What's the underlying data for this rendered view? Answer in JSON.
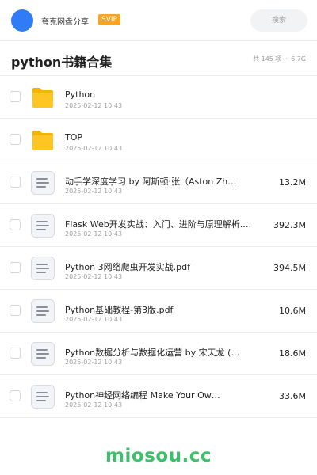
{
  "topbar": {
    "owner": "夸克网盘分享",
    "badge": "SVIP",
    "search_placeholder": "搜索"
  },
  "header": {
    "title": "python书籍合集",
    "count": "共 145 项",
    "separator": "·",
    "total_size": "6.7G"
  },
  "files": [
    {
      "type": "folder",
      "name": "Python",
      "date": "2025-02-12 10:43",
      "size": ""
    },
    {
      "type": "folder",
      "name": "TOP",
      "date": "2025-02-12 10:43",
      "size": ""
    },
    {
      "type": "document",
      "name": "动手学深度学习 by 阿斯顿·张（Aston Zh…",
      "date": "2025-02-12 10:43",
      "size": "13.2M"
    },
    {
      "type": "document",
      "name": "Flask Web开发实战：入门、进阶与原理解析.…",
      "date": "2025-02-12 10:43",
      "size": "392.3M"
    },
    {
      "type": "document",
      "name": "Python 3网络爬虫开发实战.pdf",
      "date": "2025-02-12 10:43",
      "size": "394.5M"
    },
    {
      "type": "document",
      "name": "Python基础教程-第3版.pdf",
      "date": "2025-02-12 10:43",
      "size": "10.6M"
    },
    {
      "type": "document",
      "name": "Python数据分析与数据化运营 by 宋天龙 (…",
      "date": "2025-02-12 10:43",
      "size": "18.6M"
    },
    {
      "type": "document",
      "name": "Python神经网络编程 Make Your Ow…",
      "date": "2025-02-12 10:43",
      "size": "33.6M"
    }
  ],
  "footer": {
    "brand": "miosou.cc"
  },
  "colors": {
    "folder": "#ffc522",
    "brand": "#3cc06a",
    "badge": "#f6a623",
    "avatar": "#2f7cf6"
  }
}
